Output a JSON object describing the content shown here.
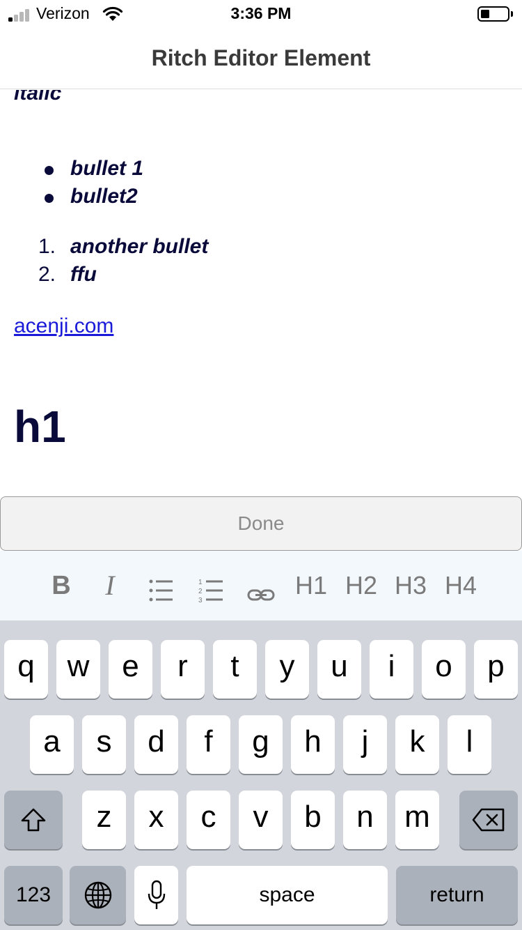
{
  "status_bar": {
    "carrier": "Verizon",
    "time": "3:36 PM",
    "signal_bars_active": 1,
    "battery_level": 0.25
  },
  "nav": {
    "title": "Ritch Editor Element"
  },
  "editor": {
    "italic_text": "italic",
    "bullets": [
      "bullet 1",
      "bullet2"
    ],
    "ordered": [
      {
        "number": "1.",
        "text": "another bullet"
      },
      {
        "number": "2.",
        "text": "ffu"
      }
    ],
    "link_text": "acenji.com",
    "heading_text": "h1"
  },
  "done_button": {
    "label": "Done"
  },
  "toolbar": {
    "bold_label": "B",
    "italic_label": "I",
    "bullet_list_icon": "bullet-list-icon",
    "numbered_list_icon": "numbered-list-icon",
    "link_icon": "link-icon",
    "h1_label": "H1",
    "h2_label": "H2",
    "h3_label": "H3",
    "h4_label": "H4"
  },
  "keyboard": {
    "row1": [
      "q",
      "w",
      "e",
      "r",
      "t",
      "y",
      "u",
      "i",
      "o",
      "p"
    ],
    "row2": [
      "a",
      "s",
      "d",
      "f",
      "g",
      "h",
      "j",
      "k",
      "l"
    ],
    "row3": [
      "z",
      "x",
      "c",
      "v",
      "b",
      "n",
      "m"
    ],
    "numbers_label": "123",
    "space_label": "space",
    "return_label": "return"
  },
  "colors": {
    "text": "#0a0a3a",
    "link": "#1a1ad9",
    "toolbar_bg": "#f3f8fc",
    "keyboard_bg": "#d2d5db"
  }
}
